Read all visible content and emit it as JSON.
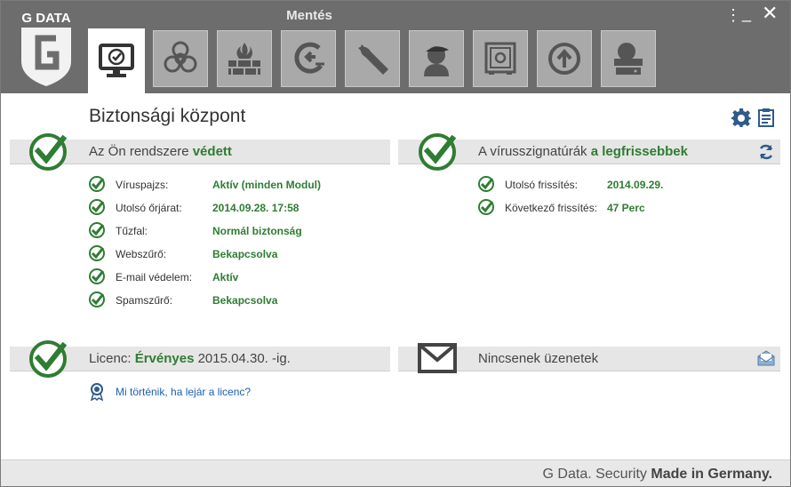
{
  "app": {
    "brand": "G DATA",
    "title": "Mentés"
  },
  "tabs": [
    {
      "name": "security-center",
      "icon": "monitor-check-icon",
      "active": true
    },
    {
      "name": "virus-protection",
      "icon": "biohazard-icon",
      "active": false
    },
    {
      "name": "firewall",
      "icon": "firewall-icon",
      "active": false
    },
    {
      "name": "backup",
      "icon": "backup-icon",
      "active": false
    },
    {
      "name": "tuner",
      "icon": "wrench-icon",
      "active": false
    },
    {
      "name": "parental-control",
      "icon": "child-icon",
      "active": false
    },
    {
      "name": "data-safe",
      "icon": "safe-icon",
      "active": false
    },
    {
      "name": "autostart-manager",
      "icon": "upload-icon",
      "active": false
    },
    {
      "name": "device-control",
      "icon": "device-icon",
      "active": false
    }
  ],
  "page": {
    "title": "Biztonsági központ"
  },
  "system": {
    "prefix": "Az Ön rendszere ",
    "status": "védett",
    "rows": [
      {
        "label": "Víruspajzs:",
        "value": "Aktív (minden Modul)"
      },
      {
        "label": "Utolsó őrjárat:",
        "value": "2014.09.28. 17:58"
      },
      {
        "label": "Tűzfal:",
        "value": "Normál biztonság"
      },
      {
        "label": "Webszűrő:",
        "value": "Bekapcsolva"
      },
      {
        "label": "E-mail védelem:",
        "value": "Aktív"
      },
      {
        "label": "Spamszűrő:",
        "value": "Bekapcsolva"
      }
    ]
  },
  "signatures": {
    "prefix": "A vírusszignatúrák ",
    "status": "a legfrissebbek",
    "rows": [
      {
        "label": "Utolsó frissítés:",
        "value": "2014.09.29."
      },
      {
        "label": "Következő frissítés:",
        "value": "47 Perc"
      }
    ]
  },
  "license": {
    "prefix": "Licenc: ",
    "status": "Érvényes",
    "suffix": " 2015.04.30. -ig.",
    "link": "Mi történik, ha lejár a licenc?"
  },
  "messages": {
    "title": "Nincsenek üzenetek"
  },
  "footer": {
    "text": "G Data. Security ",
    "bold": "Made in Germany."
  },
  "colors": {
    "accent_green": "#2e7d32",
    "titlebar": "#6d6d6d",
    "link": "#1a5fb4"
  }
}
